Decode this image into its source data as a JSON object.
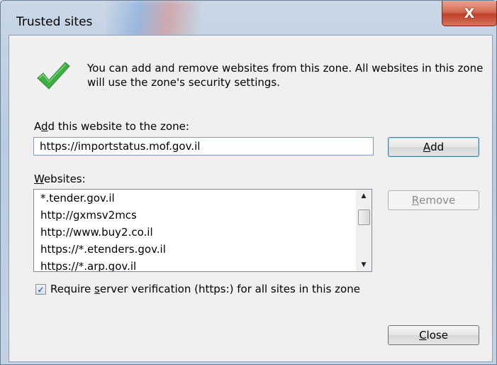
{
  "window": {
    "title": "Trusted sites",
    "close_glyph": "X"
  },
  "dialog": {
    "info_text": "You can add and remove websites from this zone. All websites in this zone will use the zone's security settings.",
    "add_label_pre": "A",
    "add_label_mnemonic": "d",
    "add_label_post": "d this website to the zone:",
    "url_input_value": "https://importstatus.mof.gov.il",
    "add_button_mnemonic": "A",
    "add_button_rest": "dd",
    "websites_label_mnemonic": "W",
    "websites_label_rest": "ebsites:",
    "websites": [
      "*.tender.gov.il",
      "http://gxmsv2mcs",
      "http://www.buy2.co.il",
      "https://*.etenders.gov.il",
      "https://*.arp.gov.il"
    ],
    "remove_button_mnemonic": "R",
    "remove_button_rest": "emove",
    "checkbox_checked": true,
    "checkbox_label_pre": "Require ",
    "checkbox_label_mnemonic": "s",
    "checkbox_label_post": "erver verification (https:) for all sites in this zone",
    "close_button_mnemonic": "C",
    "close_button_rest": "lose"
  },
  "icons": {
    "check": "checkmark-icon",
    "scroll_up": "scroll-up-arrow-icon",
    "scroll_down": "scroll-down-arrow-icon"
  },
  "colors": {
    "check_green": "#3cb043",
    "close_red": "#c0412a"
  }
}
